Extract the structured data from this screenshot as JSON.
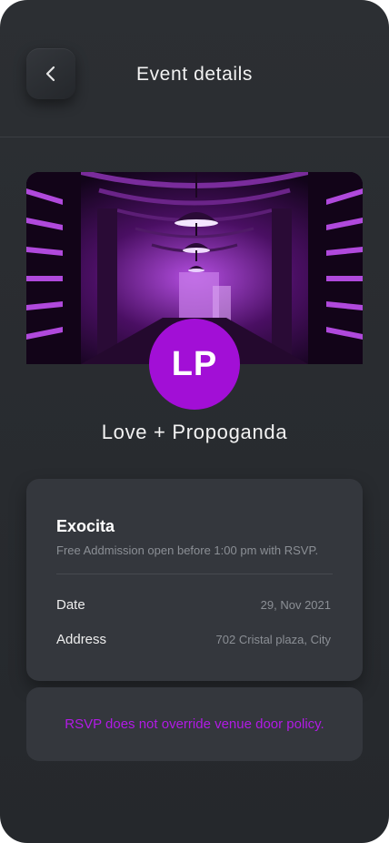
{
  "header": {
    "title": "Event details",
    "back_icon": "chevron-left-icon"
  },
  "banner": {
    "image_description": "purple-lit industrial corridor with hanging lamps",
    "tint_color": "#9b1fd0"
  },
  "event": {
    "avatar_initials": "LP",
    "avatar_color": "#a20fd6",
    "name": "Love + Propoganda"
  },
  "venue_card": {
    "venue_name": "Exocita",
    "description": "Free Addmission open before 1:00 pm with RSVP.",
    "rows": [
      {
        "label": "Date",
        "value": "29, Nov 2021"
      },
      {
        "label": "Address",
        "value": "702 Cristal plaza, City"
      }
    ]
  },
  "notice": {
    "text": "RSVP does not override venue door policy.",
    "color": "#b21ae6"
  },
  "colors": {
    "background": "#2a2d31",
    "card": "#34373d",
    "accent": "#a20fd6"
  }
}
